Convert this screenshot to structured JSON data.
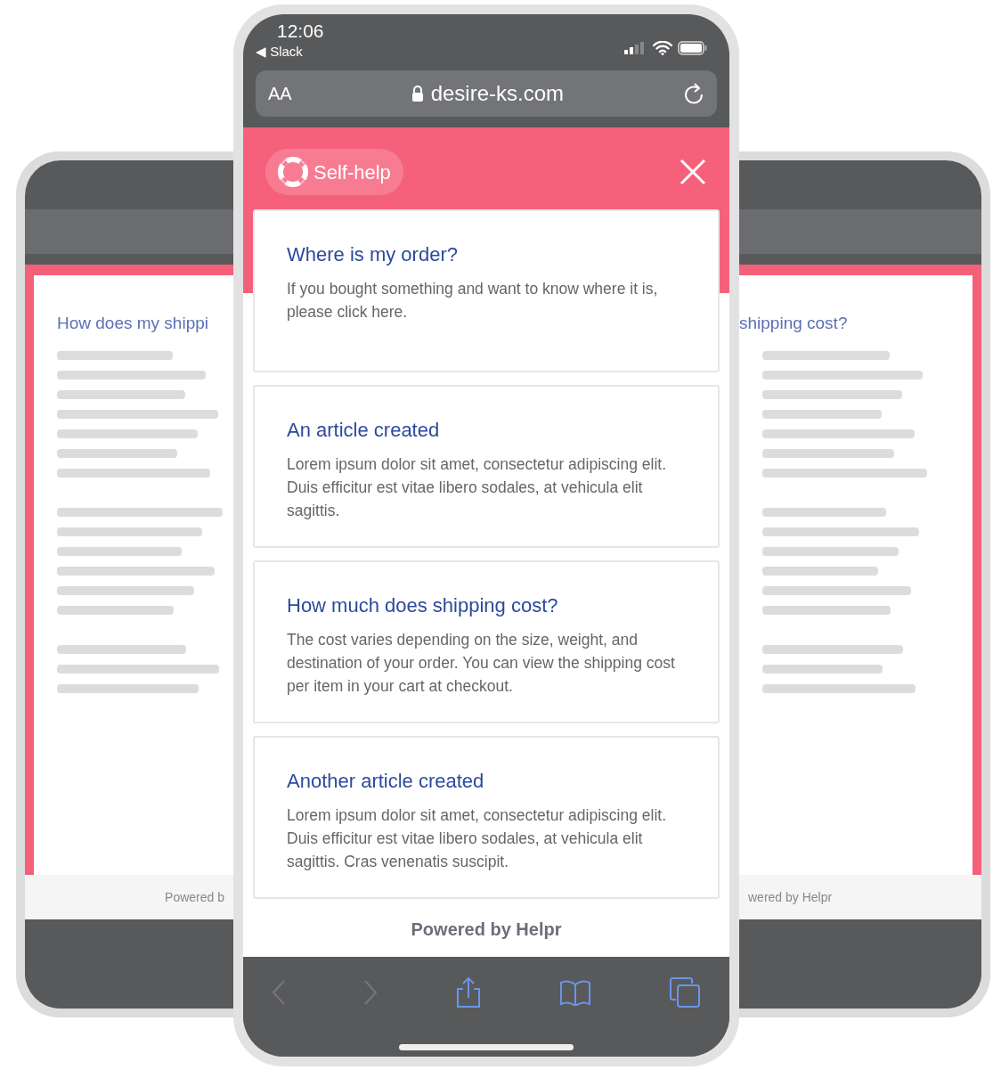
{
  "back_phones": [
    {
      "kind": "left",
      "heading": "How does my shippi",
      "footer": "Powered b"
    },
    {
      "kind": "right",
      "heading": "shipping cost?",
      "footer": "wered by Helpr"
    }
  ],
  "status_bar": {
    "time": "12:06",
    "back_app": "◀ Slack"
  },
  "address_bar": {
    "text_size": "AA",
    "url": "desire-ks.com"
  },
  "header": {
    "badge": "Self-help"
  },
  "articles": [
    {
      "title": "Where is my order?",
      "body": "If you bought something and want to know where it is, please click here."
    },
    {
      "title": "An article created",
      "body": "Lorem ipsum dolor sit amet, consectetur adipiscing elit. Duis efficitur est vitae libero sodales, at vehicula elit sagittis."
    },
    {
      "title": "How much does shipping cost?",
      "body": "The cost varies depending on the size, weight, and destination of your order. You can view the shipping cost per item in your cart at checkout."
    },
    {
      "title": "Another article created",
      "body": "Lorem ipsum dolor sit amet, consectetur adipiscing elit. Duis efficitur est vitae libero sodales, at vehicula elit sagittis. Cras venenatis suscipit."
    }
  ],
  "footer": "Powered by Helpr"
}
